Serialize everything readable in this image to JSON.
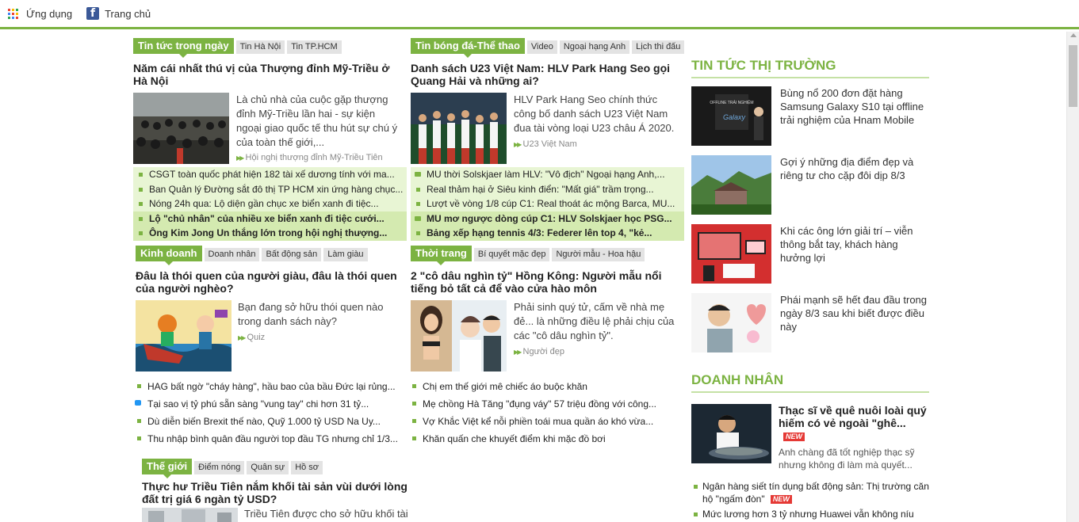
{
  "bookmarks": {
    "apps_label": "Ứng dụng",
    "home_label": "Trang chủ",
    "apps_colors": [
      "#ea4335",
      "#fbbc05",
      "#34a853",
      "#4285f4",
      "#ea4335",
      "#fbbc05",
      "#34a853",
      "#4285f4",
      "#ea4335"
    ]
  },
  "news": {
    "section": "Tin tức trong ngày",
    "tabs": [
      "Tin Hà Nội",
      "Tin TP.HCM"
    ],
    "headline": "Năm cái nhất thú vị của Thượng đỉnh Mỹ-Triều ở Hà Nội",
    "summary": "Là chủ nhà của cuộc gặp thượng đỉnh Mỹ-Triều lần hai - sự kiện ngoại giao quốc tế thu hút sự chú ý của toàn thế giới,...",
    "tag": "Hội nghị thượng đỉnh Mỹ-Triều Tiên",
    "items": [
      "CSGT toàn quốc phát hiện 182 tài xế dương tính với ma...",
      "Ban Quản lý Đường sắt đô thị TP HCM xin ứng hàng chục...",
      "Nóng 24h qua: Lộ diện gần chục xe biển xanh đi tiệc...",
      "Lộ \"chủ nhân\" của nhiều xe biển xanh đi tiệc cưới...",
      "Ông Kim Jong Un thắng lớn trong hội nghị thượng..."
    ]
  },
  "sport": {
    "section": "Tin bóng đá-Thể thao",
    "tabs": [
      "Video",
      "Ngoại hạng Anh",
      "Lịch thi đấu"
    ],
    "headline": "Danh sách U23 Việt Nam: HLV Park Hang Seo gọi Quang Hải và những ai?",
    "summary": "HLV Park Hang Seo chính thức công bố danh sách U23 Việt Nam đua tài vòng loại U23 châu Á 2020.",
    "tag": "U23 Việt Nam",
    "items": [
      "MU thời Solskjaer làm HLV: \"Vô địch\" Ngoại hạng Anh,...",
      "Real thảm hại ở Siêu kinh điển: \"Mất giá\" trầm trọng...",
      "Lượt về vòng 1/8 cúp C1: Real thoát ác mộng Barca, MU...",
      "MU mơ ngược dòng cúp C1: HLV Solskjaer học PSG...",
      "Bảng xếp hạng tennis 4/3: Federer lên top 4, \"kẻ..."
    ]
  },
  "business": {
    "section": "Kinh doanh",
    "tabs": [
      "Doanh nhân",
      "Bất động sản",
      "Làm giàu"
    ],
    "headline": "Đâu là thói quen của người giàu, đâu là thói quen của người nghèo?",
    "summary": "Bạn đang sở hữu thói quen nào trong danh sách này?",
    "tag": "Quiz",
    "items": [
      "HAG bất ngờ \"cháy hàng\", hầu bao của bầu Đức lại rủng...",
      "Tại sao vị tỷ phú sẵn sàng \"vung tay\" chi hơn 31 tỷ...",
      "Dù diễn biến Brexit thế nào, Quỹ 1.000 tỷ USD Na Uy...",
      "Thu nhập bình quân đầu người top đầu TG nhưng chỉ 1/3..."
    ]
  },
  "fashion": {
    "section": "Thời trang",
    "tabs": [
      "Bí quyết mặc đẹp",
      "Người mẫu - Hoa hậu"
    ],
    "headline": "2 \"cô dâu nghìn tỷ\" Hồng Kông: Người mẫu nổi tiếng bỏ tất cả để vào cửa hào môn",
    "summary": "Phải sinh quý tử, cấm về nhà mẹ đẻ... là những điều lệ phải chịu của các \"cô dâu nghìn tỷ\".",
    "tag": "Người đẹp",
    "items": [
      "Chị em thế giới mê chiếc áo buộc khăn",
      "Mẹ chồng Hà Tăng \"đụng váy\" 57 triệu đồng với công...",
      "Vợ Khắc Việt kể nỗi phiền toái mua quần áo khó vừa...",
      "Khăn quấn che khuyết điểm khi mặc đồ bơi"
    ]
  },
  "world": {
    "section": "Thế giới",
    "tabs": [
      "Điểm nóng",
      "Quân sự",
      "Hồ sơ"
    ],
    "headline": "Thực hư Triều Tiên nắm khối tài sản vùi dưới lòng đất trị giá 6 ngàn tỷ USD?",
    "summary": "Triều Tiên được cho sở hữu khối tài"
  },
  "market": {
    "title": "TIN TỨC THỊ TRƯỜNG",
    "items": [
      "Bùng nổ 200 đơn đặt hàng Samsung Galaxy S10 tại offline trải nghiệm của Hnam Mobile",
      "Gợi ý những địa điểm đẹp và riêng tư cho cặp đôi dịp 8/3",
      "Khi các ông lớn giải trí – viễn thông bắt tay, khách hàng hưởng lợi",
      "Phái mạnh sẽ hết đau đầu trong ngày 8/3 sau khi biết được điều này"
    ],
    "thumb_text": "OFFLINE TRẢI NGHIỆM",
    "thumb_brand": "Galaxy"
  },
  "entrepreneur": {
    "title": "DOANH NHÂN",
    "headline": "Thạc sĩ về quê nuôi loài quý hiếm có vẻ ngoài \"ghê...",
    "new_label": "NEW",
    "summary": "Anh chàng đã tốt nghiệp thạc sỹ nhưng không đi làm mà quyết...",
    "items": [
      "Ngân hàng siết tín dụng bất động sản: Thị trường căn hộ \"ngấm đòn\"",
      "Mức lương hơn 3 tỷ nhưng Huawei vẫn không níu"
    ]
  }
}
